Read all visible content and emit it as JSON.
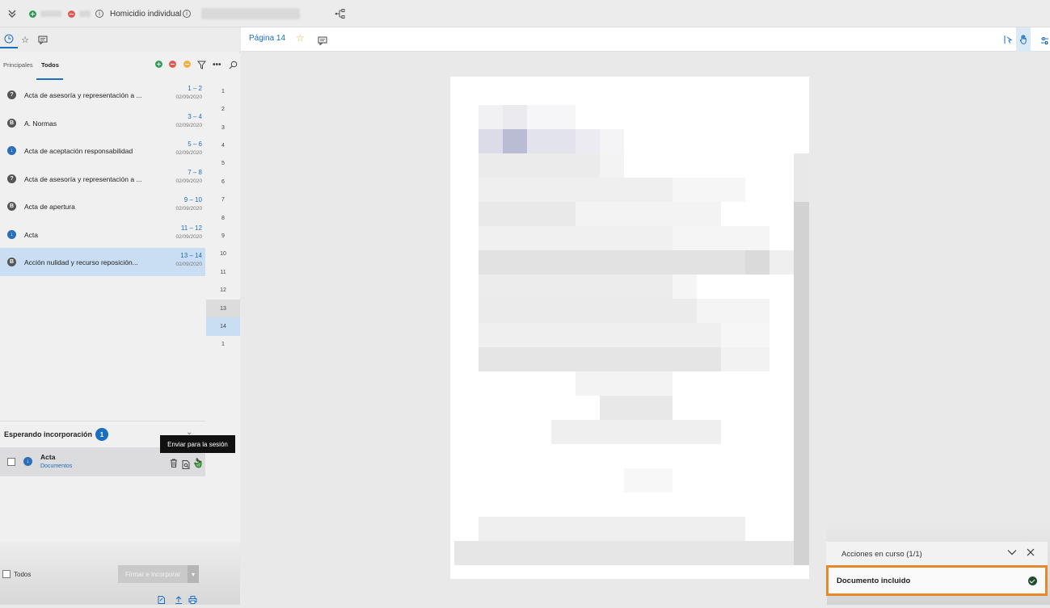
{
  "topbar": {
    "title": "Homicidio individual",
    "info_icon": "info-icon",
    "expand_icon": "chevron-double-down-icon",
    "share_icon": "tree-icon"
  },
  "left_tabs": {
    "icons": [
      "clock-icon",
      "star-icon",
      "comment-icon"
    ]
  },
  "subtabs": {
    "principales": "Principales",
    "todos": "Todos"
  },
  "toolbar_icons": [
    "add-icon",
    "remove-icon",
    "circle-icon",
    "filter-icon",
    "more-icon",
    "search-icon"
  ],
  "documents": [
    {
      "icon": "?",
      "icon_color": "gray",
      "name": "Acta de asesoría y representación a ...",
      "range": "1 – 2",
      "date": "02/09/2020"
    },
    {
      "icon": "B",
      "icon_color": "gray",
      "name": "A. Normas",
      "range": "3 – 4",
      "date": "02/09/2020"
    },
    {
      "icon": "↓",
      "icon_color": "blue",
      "name": "Acta de aceptación responsabilidad",
      "range": "5 – 6",
      "date": "02/09/2020"
    },
    {
      "icon": "?",
      "icon_color": "gray",
      "name": "Acta de asesoría y representación a ...",
      "range": "7 – 8",
      "date": "02/09/2020"
    },
    {
      "icon": "B",
      "icon_color": "gray",
      "name": "Acta de apertura",
      "range": "9 – 10",
      "date": "02/09/2020"
    },
    {
      "icon": "↓",
      "icon_color": "blue",
      "name": "Acta",
      "range": "11 – 12",
      "date": "02/09/2020"
    },
    {
      "icon": "B",
      "icon_color": "gray",
      "name": "Acción nulidad y recurso reposición...",
      "range": "13 – 14",
      "date": "02/09/2020",
      "selected": true
    }
  ],
  "page_numbers": [
    "1",
    "2",
    "3",
    "4",
    "5",
    "6",
    "7",
    "8",
    "9",
    "10",
    "11",
    "12",
    "13",
    "14",
    "1"
  ],
  "waiting": {
    "title": "Esperando incorporación",
    "count": "1",
    "item_name": "Acta",
    "item_sub": "Documentos",
    "tooltip": "Enviar para la sesión"
  },
  "footer_left": {
    "todos_label": "Todos",
    "firmar_button": "Firmar e incorporar"
  },
  "viewer": {
    "page_label": "Página 14"
  },
  "actions": {
    "title": "Acciones en curso (1/1)",
    "item": "Documento incluido"
  }
}
